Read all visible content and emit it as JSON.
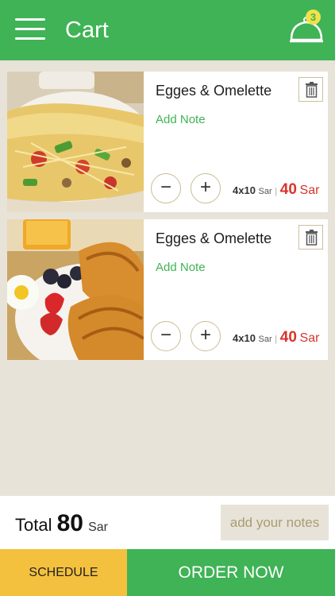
{
  "header": {
    "title": "Cart",
    "cart_count": "3"
  },
  "items": [
    {
      "name": "Egges & Omelette",
      "add_note_label": "Add Note",
      "minus_label": "−",
      "plus_label": "+",
      "quantity": "4x10",
      "unit_price_unit": "Sar",
      "separator": "|",
      "amount": "40",
      "amount_unit": "Sar",
      "image": "omelette-photo"
    },
    {
      "name": "Egges & Omelette",
      "add_note_label": "Add Note",
      "minus_label": "−",
      "plus_label": "+",
      "quantity": "4x10",
      "unit_price_unit": "Sar",
      "separator": "|",
      "amount": "40",
      "amount_unit": "Sar",
      "image": "croissant-photo"
    }
  ],
  "summary": {
    "total_label": "Total",
    "total_value": "80",
    "total_unit": "Sar",
    "notes_button": "add your notes"
  },
  "actions": {
    "schedule": "SCHEDULE",
    "order_now": "ORDER NOW"
  },
  "colors": {
    "brand_green": "#3fb356",
    "price_red": "#d8342b",
    "schedule_yellow": "#f4c13e",
    "background": "#e8e3d8"
  }
}
